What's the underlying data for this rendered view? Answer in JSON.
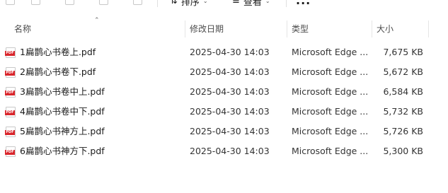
{
  "toolbar": {
    "sort_label": "排序",
    "view_label": "查看",
    "more_label": "..."
  },
  "columns": {
    "name": "名称",
    "modified": "修改日期",
    "type": "类型",
    "size": "大小"
  },
  "files": [
    {
      "name": "1扁鹊心书卷上.pdf",
      "modified": "2025-04-30 14:03",
      "type": "Microsoft Edge ...",
      "size": "7,675 KB",
      "icon": "pdf-icon"
    },
    {
      "name": "2扁鹊心书卷下.pdf",
      "modified": "2025-04-30 14:03",
      "type": "Microsoft Edge ...",
      "size": "5,672 KB",
      "icon": "pdf-icon"
    },
    {
      "name": "3扁鹊心书卷中上.pdf",
      "modified": "2025-04-30 14:03",
      "type": "Microsoft Edge ...",
      "size": "6,584 KB",
      "icon": "pdf-icon"
    },
    {
      "name": "4扁鹊心书卷中下.pdf",
      "modified": "2025-04-30 14:03",
      "type": "Microsoft Edge ...",
      "size": "5,732 KB",
      "icon": "pdf-icon"
    },
    {
      "name": "5扁鹊心书神方上.pdf",
      "modified": "2025-04-30 14:03",
      "type": "Microsoft Edge ...",
      "size": "5,726 KB",
      "icon": "pdf-icon"
    },
    {
      "name": "6扁鹊心书神方下.pdf",
      "modified": "2025-04-30 14:03",
      "type": "Microsoft Edge ...",
      "size": "5,300 KB",
      "icon": "pdf-icon"
    }
  ]
}
